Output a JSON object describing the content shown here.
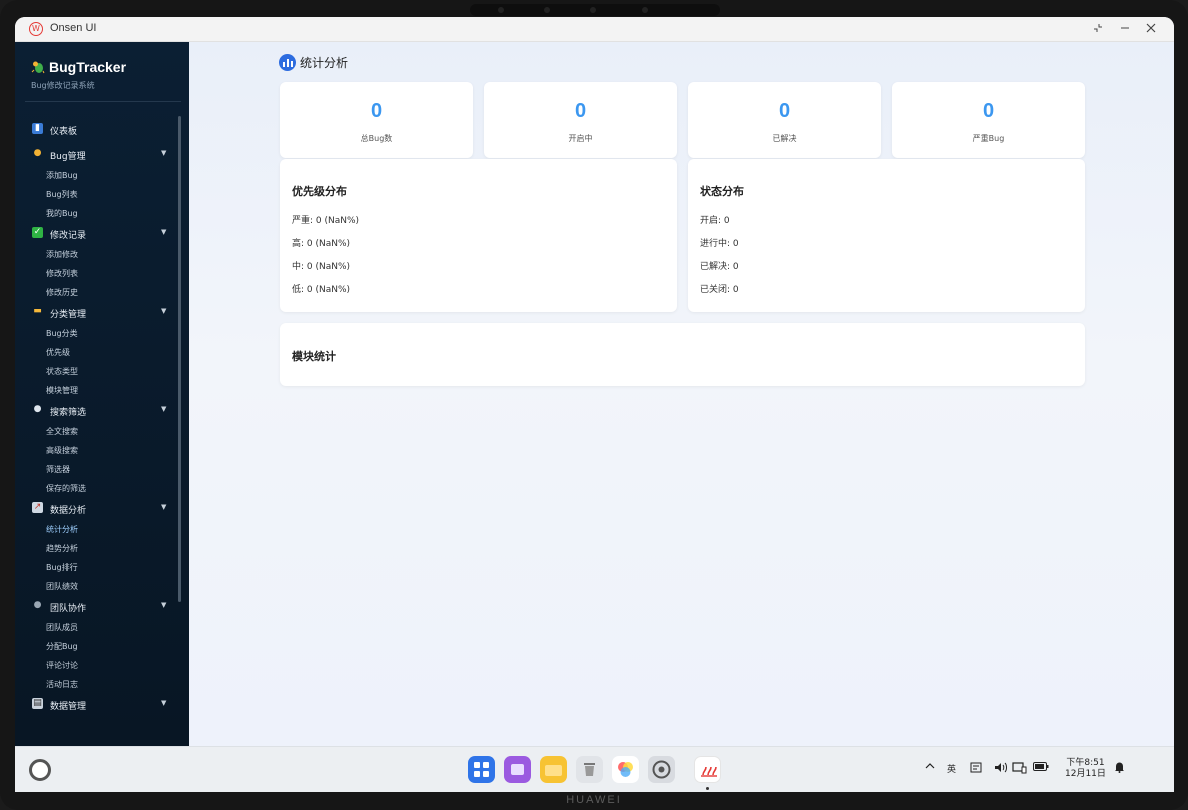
{
  "window": {
    "title": "Onsen UI",
    "app_logo_icon": "onsen-logo-icon"
  },
  "sidebar": {
    "brand": {
      "name": "BugTracker",
      "subtitle": "Bug修改记录系统",
      "icon": "bug-icon"
    },
    "groups": [
      {
        "label": "仪表板",
        "icon": "bar-chart-icon",
        "expandable": false,
        "items": []
      },
      {
        "label": "Bug管理",
        "icon": "bug-icon",
        "expandable": true,
        "items": [
          "添加Bug",
          "Bug列表",
          "我的Bug"
        ]
      },
      {
        "label": "修改记录",
        "icon": "checkmark-icon",
        "expandable": true,
        "items": [
          "添加修改",
          "修改列表",
          "修改历史"
        ]
      },
      {
        "label": "分类管理",
        "icon": "folder-icon",
        "expandable": true,
        "items": [
          "Bug分类",
          "优先级",
          "状态类型",
          "模块管理"
        ]
      },
      {
        "label": "搜索筛选",
        "icon": "search-icon",
        "expandable": true,
        "items": [
          "全文搜索",
          "高级搜索",
          "筛选器",
          "保存的筛选"
        ]
      },
      {
        "label": "数据分析",
        "icon": "line-chart-icon",
        "expandable": true,
        "items": [
          "统计分析",
          "趋势分析",
          "Bug排行",
          "团队绩效"
        ]
      },
      {
        "label": "团队协作",
        "icon": "team-icon",
        "expandable": true,
        "items": [
          "团队成员",
          "分配Bug",
          "评论讨论",
          "活动日志"
        ]
      },
      {
        "label": "数据管理",
        "icon": "database-icon",
        "expandable": true,
        "items": []
      }
    ],
    "active_item": "统计分析"
  },
  "page": {
    "title": "统计分析",
    "title_icon": "statistics-icon"
  },
  "stats": [
    {
      "value": "0",
      "label": "总Bug数"
    },
    {
      "value": "0",
      "label": "开启中"
    },
    {
      "value": "0",
      "label": "已解决"
    },
    {
      "value": "0",
      "label": "严重Bug"
    }
  ],
  "priority_panel": {
    "title": "优先级分布",
    "rows": [
      "严重: 0 (NaN%)",
      "高: 0 (NaN%)",
      "中: 0 (NaN%)",
      "低: 0 (NaN%)"
    ]
  },
  "status_panel": {
    "title": "状态分布",
    "rows": [
      "开启: 0",
      "进行中: 0",
      "已解决: 0",
      "已关闭: 0"
    ]
  },
  "module_panel": {
    "title": "模块统计"
  },
  "taskbar": {
    "dock": [
      "app-grid-icon",
      "multitask-icon",
      "files-icon",
      "trash-icon",
      "gallery-icon",
      "settings-icon",
      "onsen-app-icon"
    ],
    "input_method": "英",
    "clock": {
      "time": "下午8:51",
      "date": "12月11日"
    }
  },
  "device_brand": "HUAWEI",
  "colors": {
    "accent": "#3b97f0",
    "sidebar_bg": "#0b1f33",
    "brand_red": "#e53935"
  }
}
